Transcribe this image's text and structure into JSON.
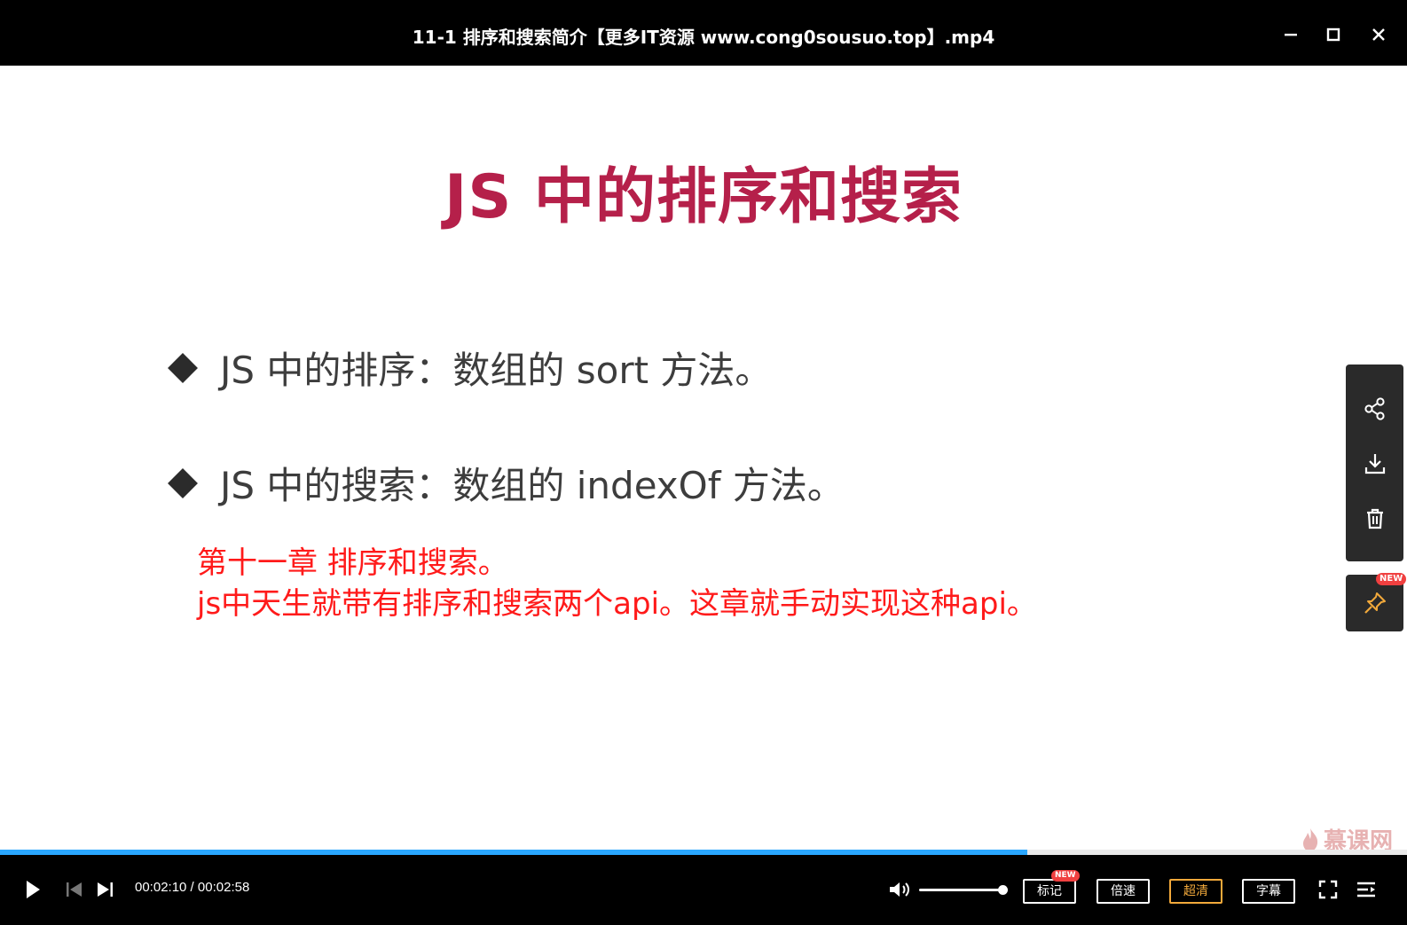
{
  "window": {
    "title": "11-1 排序和搜索简介【更多IT资源 www.cong0sousuo.top】.mp4"
  },
  "slide": {
    "title": "JS 中的排序和搜索",
    "bullets": [
      "JS 中的排序：数组的 sort 方法。",
      "JS 中的搜索：数组的 indexOf 方法。"
    ],
    "notes": [
      "第十一章 排序和搜索。",
      "js中天生就带有排序和搜索两个api。这章就手动实现这种api。"
    ]
  },
  "side_panel": {
    "pin_badge": "NEW"
  },
  "watermark": {
    "text": "慕课网"
  },
  "player": {
    "current_time": "00:02:10",
    "separator": " / ",
    "duration": "00:02:58",
    "progress_fraction": 0.73,
    "volume_fraction": 1.0,
    "buttons": {
      "mark": "标记",
      "mark_badge": "NEW",
      "speed": "倍速",
      "quality": "超清",
      "subtitle": "字幕"
    }
  },
  "colors": {
    "slide_title": "#b5204a",
    "note_text": "#ff1a1a",
    "progress": "#2aa7ff",
    "quality_active": "#f2a93b"
  }
}
